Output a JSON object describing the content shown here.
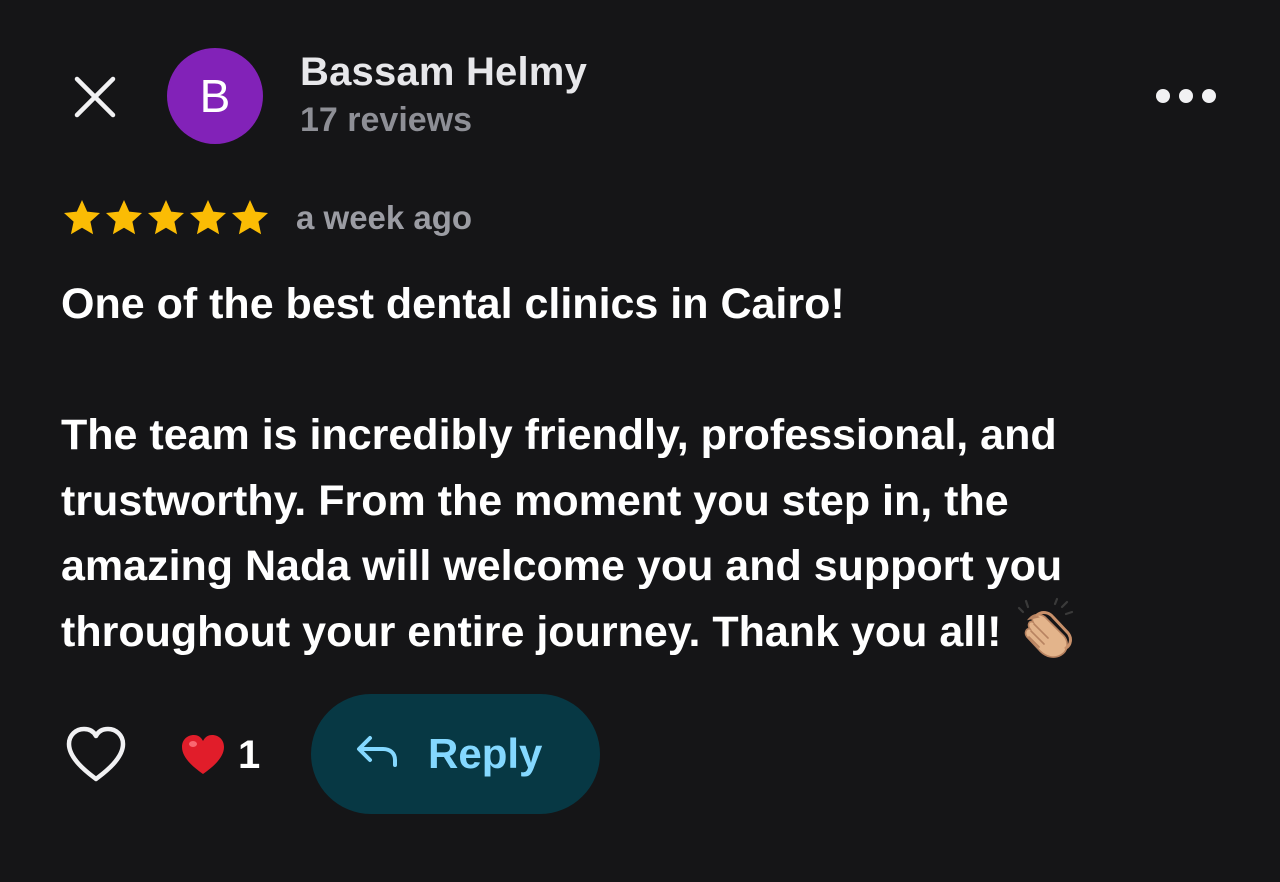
{
  "header": {
    "author_initial": "B",
    "author_name": "Bassam Helmy",
    "author_reviews": "17 reviews",
    "avatar_color": "#8222b8"
  },
  "review": {
    "rating": 5,
    "max_rating": 5,
    "star_color": "#fbbc04",
    "time_ago": "a week ago",
    "headline": "One of the best dental clinics in Cairo!",
    "body_lines": [
      "The team is incredibly friendly, professional, and",
      "trustworthy. From the moment you step in, the",
      "amazing Nada will welcome you and support you",
      "throughout your entire journey. Thank you all!"
    ],
    "emoji_icon": "clapping-hands-icon"
  },
  "actions": {
    "like_icon": "heart-outline-icon",
    "reaction_icon": "red-heart-icon",
    "reaction_count": "1",
    "reply_label": "Reply",
    "reply_icon": "reply-arrow-icon",
    "reply_bg_color": "#073844",
    "reply_text_color": "#84d8ff"
  }
}
